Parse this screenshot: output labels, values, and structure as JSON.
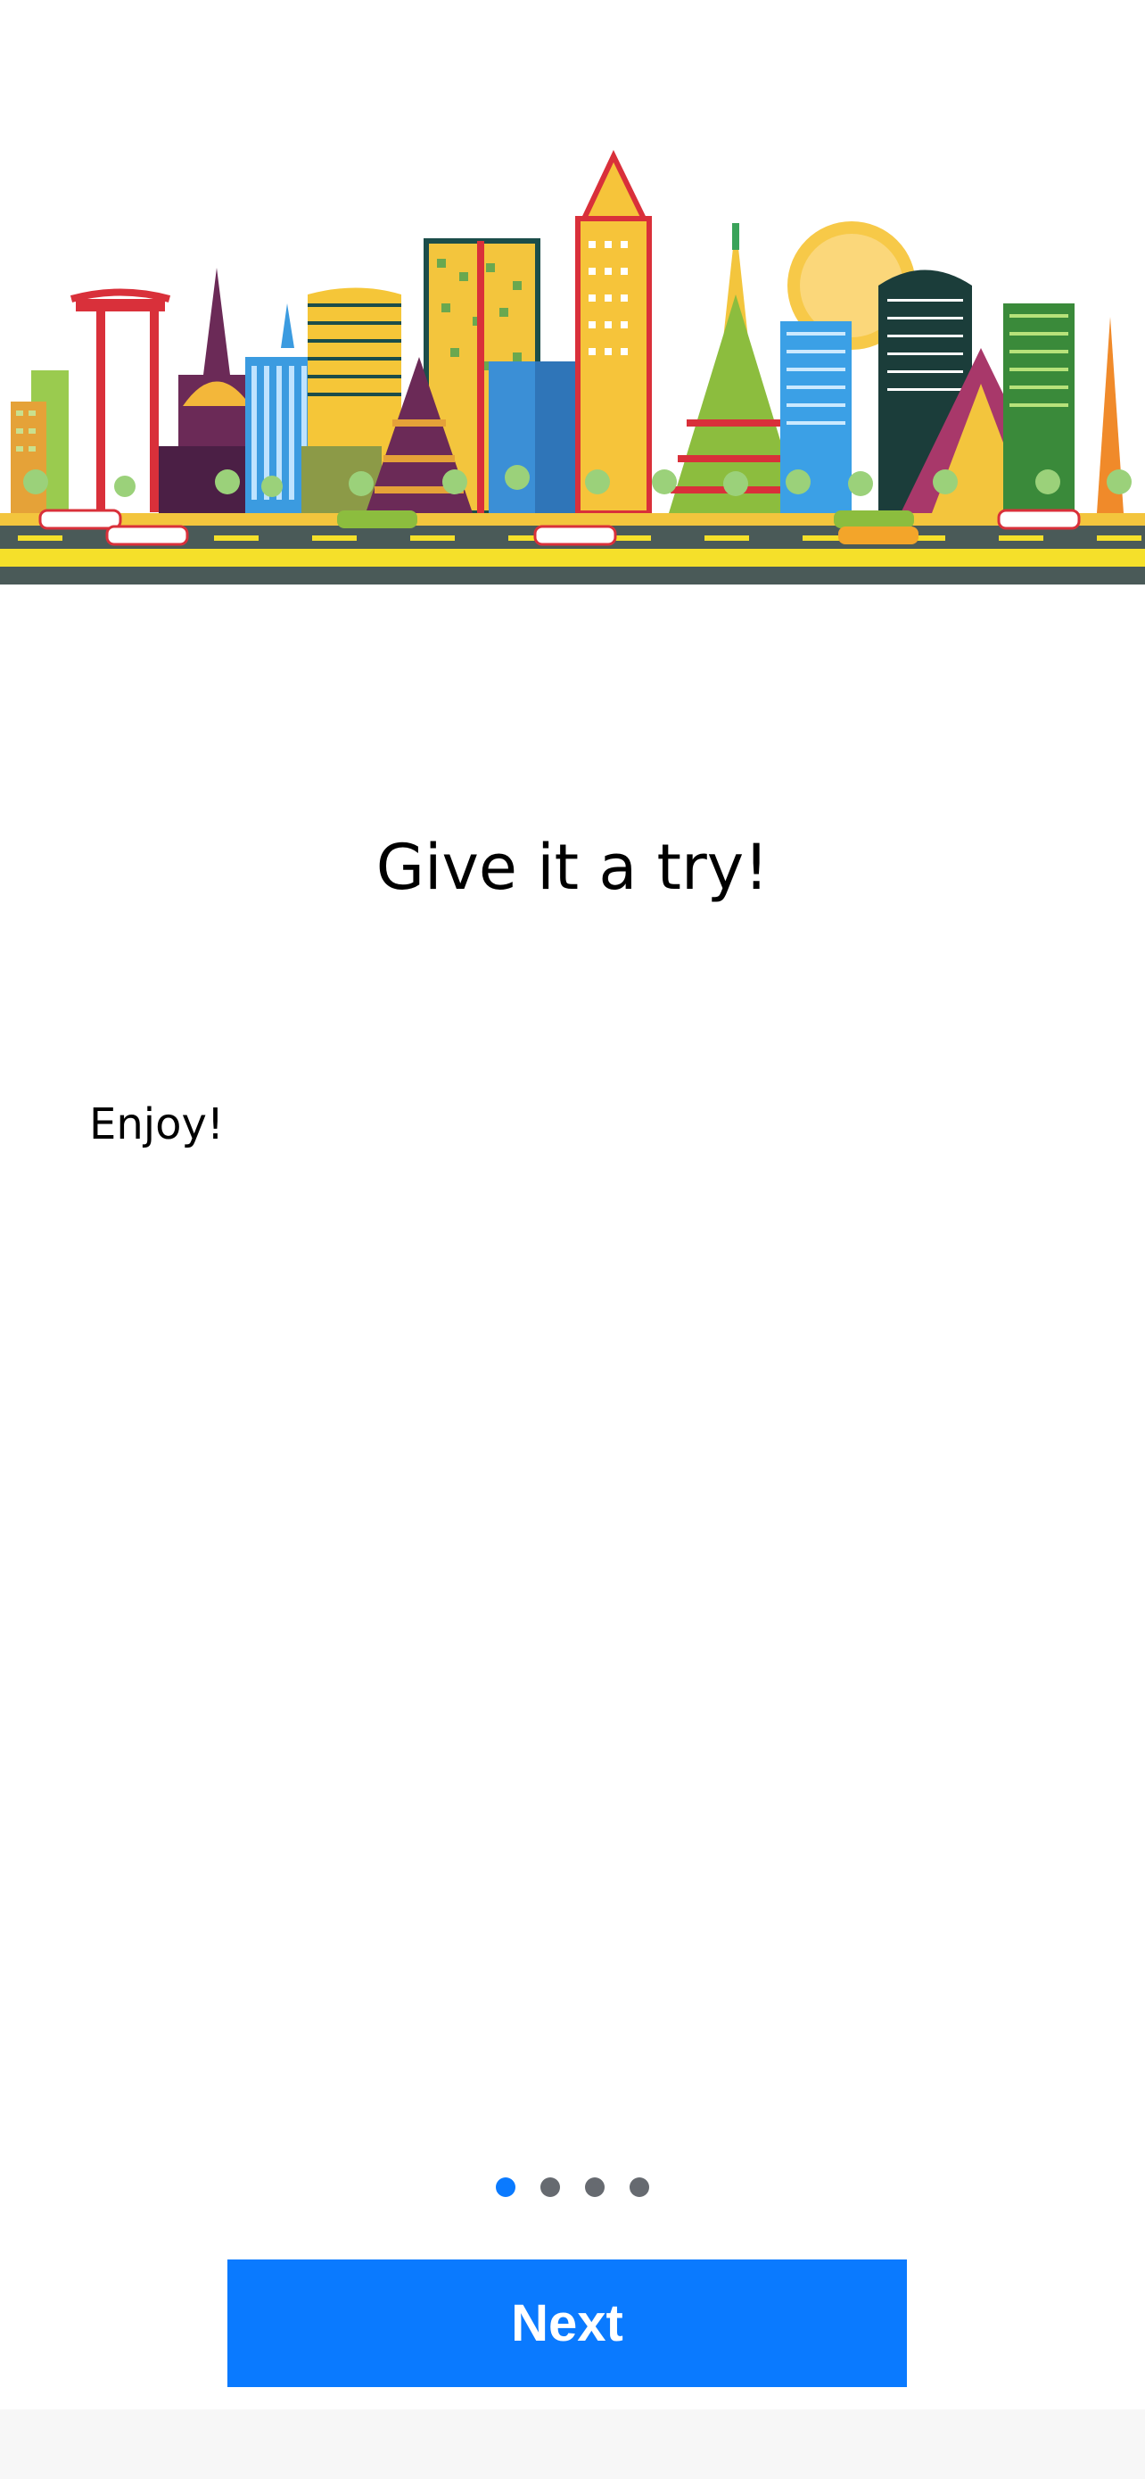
{
  "hero": {
    "illustration": "bangkok-skyline-illustration"
  },
  "onboarding": {
    "title": "Give it a try!",
    "body": "Enjoy!",
    "pages": 4,
    "current_page": 1
  },
  "actions": {
    "next_label": "Next"
  },
  "colors": {
    "accent": "#0a7aff",
    "dot_inactive": "#666a70",
    "road": "#4a5a58",
    "road_stripe": "#f5e02a"
  }
}
